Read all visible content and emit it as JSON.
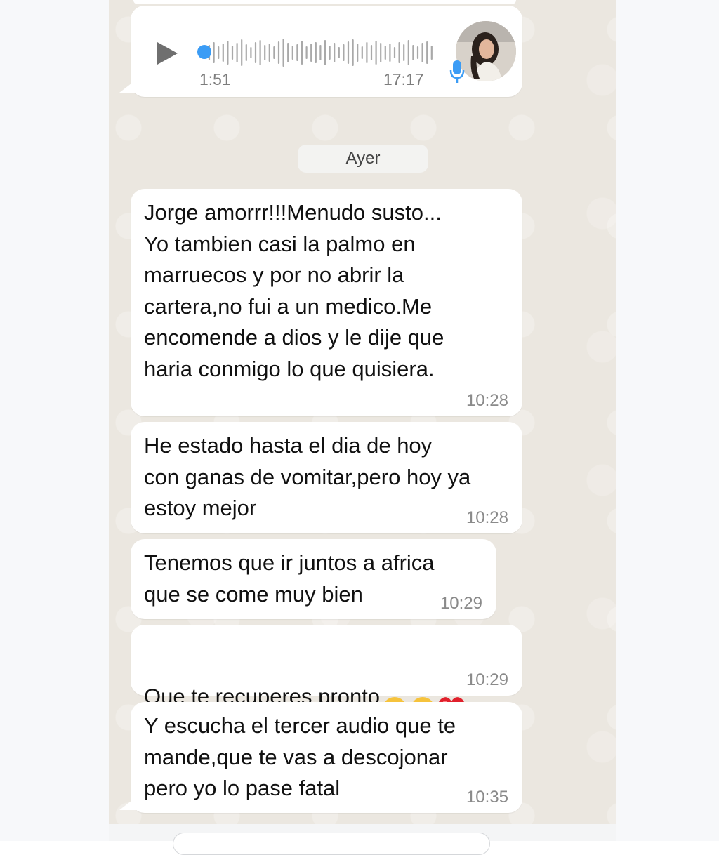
{
  "voice_message": {
    "duration": "1:51",
    "sent_time": "17:17",
    "progress": 0.0
  },
  "date_separator": "Ayer",
  "messages": [
    {
      "text": "Jorge amorrr!!!Menudo susto...\nYo tambien casi la  palmo en\nmarruecos y  por no abrir la\ncartera,no fui a un medico.Me\nencomende a dios y le dije que\nharia conmigo lo que quisiera.",
      "time": "10:28"
    },
    {
      "text": "He estado hasta el dia de hoy\ncon ganas de vomitar,pero hoy ya\nestoy mejor",
      "time": "10:28"
    },
    {
      "text": "Tenemos que ir juntos a africa\nque se come muy bien",
      "time": "10:29"
    },
    {
      "text": "Que te recuperes pronto",
      "emojis": [
        "kissing-face-heart-emoji",
        "kissing-face-heart-emoji",
        "red-heart-emoji"
      ],
      "time": "10:29"
    },
    {
      "text": "Y escucha el tercer audio que te\nmande,que te vas a descojonar\npero yo lo pase fatal",
      "time": "10:35"
    }
  ],
  "colors": {
    "chat_background": "#ebe7e0",
    "bubble": "#ffffff",
    "voice_accent": "#3b9cf5",
    "timestamp": "#8a8a8a"
  },
  "icons": {
    "play": "play-icon",
    "mic": "microphone-icon",
    "avatar": "contact-avatar"
  }
}
